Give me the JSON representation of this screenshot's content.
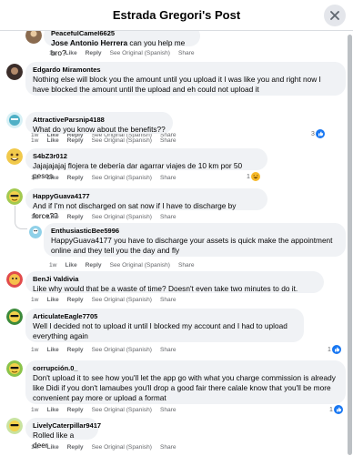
{
  "header": {
    "title": "Estrada Gregori's Post",
    "close_icon": "close-icon"
  },
  "actions_labels": {
    "time": "1w",
    "like": "Like",
    "reply": "Reply",
    "see_original": "See Original (Spanish)",
    "share": "Share"
  },
  "comments": [
    {
      "author": "PeacefulCamel6625",
      "text": "Jose Antonio Herrera can you help me bro?",
      "mention": "Jose Antonio Herrera"
    },
    {
      "author": "Edgardo Miramontes",
      "text": "Nothing else will block you the amount until you upload it I was like you and right now I have blocked the amount until the upload and eh could not upload it",
      "reactions": "3"
    },
    {
      "author": "AttractiveParsnip4188",
      "text": "What do you know about the benefits??"
    },
    {
      "author": "S4bZ3r012",
      "text": "Jajajajajaj flojera te debería dar agarrar viajes de 10 km por 50 pesos",
      "reactions": "1"
    },
    {
      "author": "HappyGuava4177",
      "text": "And if I'm not discharged on sat now if I have to discharge by force??"
    },
    {
      "author": "EnthusiasticBee5996",
      "text": "HappyGuava4177 you have to discharge your assets is quick make the appointment online and they tell you the day and fly"
    },
    {
      "author": "BenJi Valdivia",
      "text": "Like why would that be a waste of time? Doesn't even take two minutes to do it."
    },
    {
      "author": "ArticulateEagle7705",
      "text": "Well I decided not to upload it until I blocked my account and I had to upload everything again",
      "reactions": "1"
    },
    {
      "author": "corrupción.0_",
      "text": "Don't upload it to see how you'll let the app go with what you charge commission is already like Didi if you don't lamaubes you'll drop a good fair there calale know that you'll be more convenient pay more or upload a format",
      "reactions": "1"
    },
    {
      "author": "LivelyCaterpillar9417",
      "text": "Rolled like a deer"
    }
  ],
  "colors": {
    "bubble": "#f0f2f5",
    "meta": "#65676b",
    "like_blue": "#1877f2",
    "haha_yellow": "#f7b928"
  }
}
